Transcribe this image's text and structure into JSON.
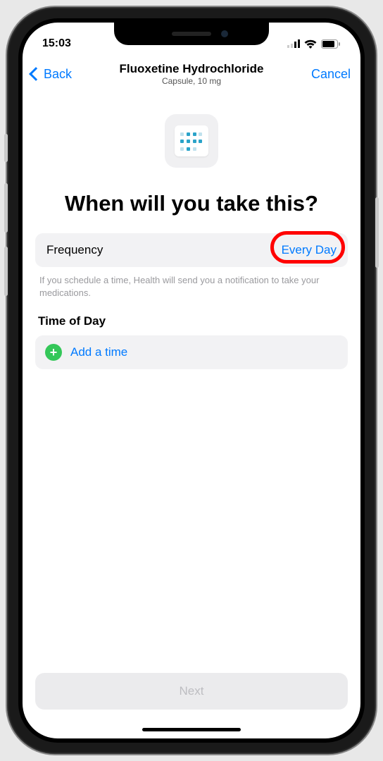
{
  "status": {
    "time": "15:03"
  },
  "nav": {
    "back_label": "Back",
    "title": "Fluoxetine Hydrochloride",
    "subtitle": "Capsule, 10 mg",
    "cancel_label": "Cancel"
  },
  "heading": "When will you take this?",
  "frequency": {
    "label": "Frequency",
    "value": "Every Day"
  },
  "helper": "If you schedule a time, Health will send you a notification to take your medications.",
  "time_of_day": {
    "section_label": "Time of Day",
    "add_label": "Add a time"
  },
  "next_label": "Next"
}
